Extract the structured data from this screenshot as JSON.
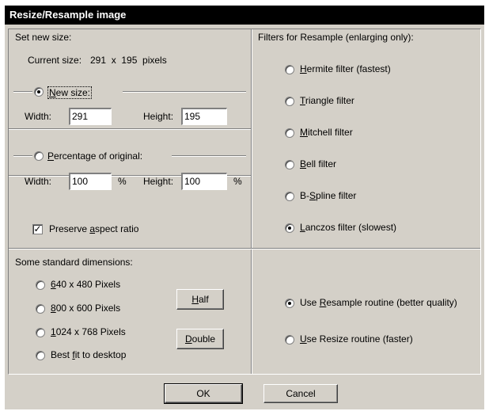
{
  "window": {
    "title": "Resize/Resample image"
  },
  "set_size": {
    "group_label": "Set new size:",
    "current_label": "Current size:",
    "current_value": "291  x  195  pixels",
    "new_size_label": "New size:",
    "new_size_selected": true,
    "width_label": "Width:",
    "height_label": "Height:",
    "width_value": "291",
    "height_value": "195",
    "percentage_label": "Percentage of original:",
    "percentage_selected": false,
    "pct_width_value": "100",
    "pct_height_value": "100",
    "pct_unit": "%",
    "preserve_label": "Preserve aspect ratio",
    "preserve_checked": true
  },
  "standard": {
    "group_label": "Some standard dimensions:",
    "options": [
      {
        "label": "640 x 480 Pixels",
        "selected": false
      },
      {
        "label": "800 x 600 Pixels",
        "selected": false
      },
      {
        "label": "1024 x 768 Pixels",
        "selected": false
      },
      {
        "label": "Best fit to desktop",
        "selected": false
      }
    ],
    "half_label": "Half",
    "double_label": "Double"
  },
  "filters": {
    "group_label": "Filters for Resample (enlarging only):",
    "options": [
      {
        "label": "Hermite filter (fastest)",
        "selected": false
      },
      {
        "label": "Triangle filter",
        "selected": false
      },
      {
        "label": "Mitchell filter",
        "selected": false
      },
      {
        "label": "Bell filter",
        "selected": false
      },
      {
        "label": "B-Spline filter",
        "selected": false
      },
      {
        "label": "Lanczos filter (slowest)",
        "selected": true
      }
    ]
  },
  "routine": {
    "options": [
      {
        "label": "Use Resample routine (better quality)",
        "selected": true
      },
      {
        "label": "Use Resize routine (faster)",
        "selected": false
      }
    ]
  },
  "buttons": {
    "ok": "OK",
    "cancel": "Cancel"
  }
}
